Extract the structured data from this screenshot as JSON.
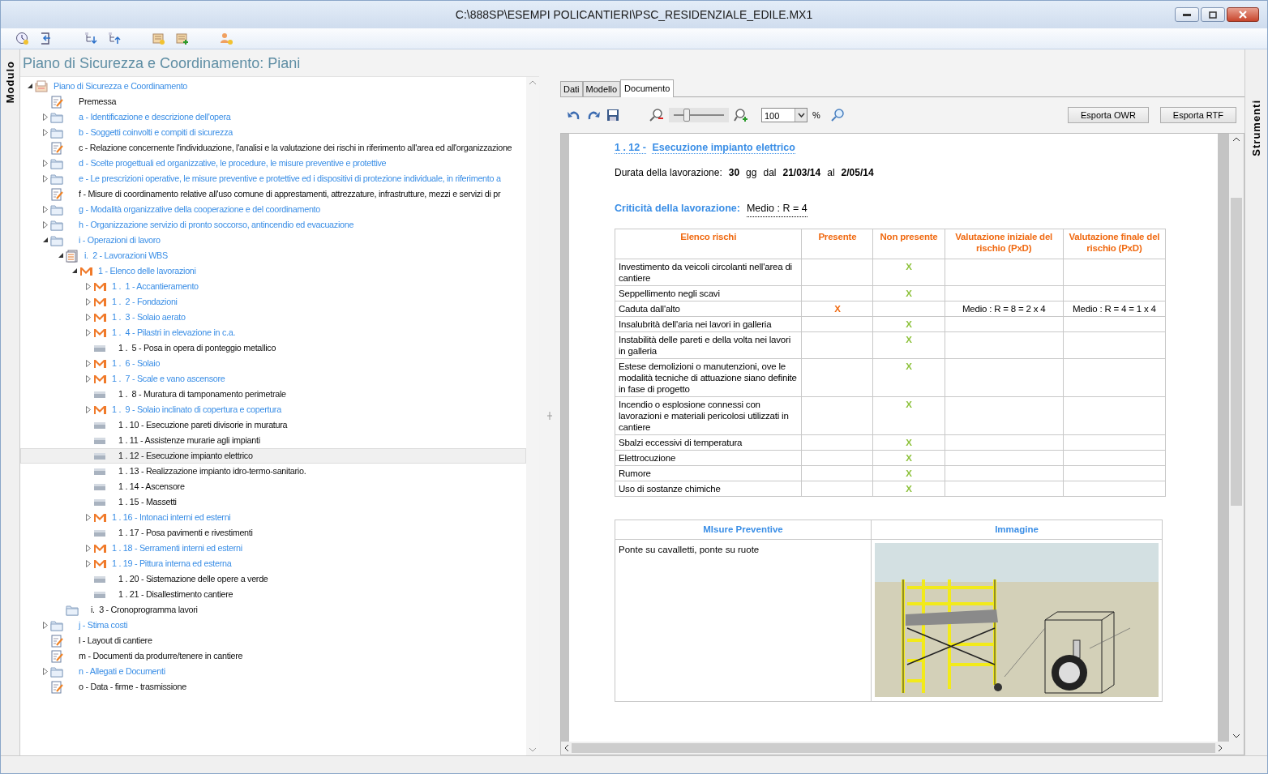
{
  "window": {
    "title": "C:\\888SP\\ESEMPI POLICANTIERI\\PSC_RESIDENZIALE_EDILE.MX1"
  },
  "side_tabs": {
    "left": "Modulo",
    "right": "Strumenti"
  },
  "panel_title": "Piano di Sicurezza e Coordinamento: Piani",
  "tree": [
    {
      "text": "Piano di Sicurezza e Coordinamento",
      "kind": "plan",
      "expanded": true,
      "selected": false,
      "children": [
        {
          "text": "Premessa",
          "kind": "document",
          "selected": false
        },
        {
          "text": "a - Identificazione e descrizione dell'opera",
          "kind": "folder",
          "expanded": false,
          "selected": false
        },
        {
          "text": "b - Soggetti coinvolti e compiti di sicurezza",
          "kind": "folder",
          "expanded": false,
          "selected": false
        },
        {
          "text": "c - Relazione concernente l'individuazione, l'analisi e la valutazione dei rischi in riferimento all'area ed all'organizzazione",
          "kind": "document",
          "selected": false
        },
        {
          "text": "d - Scelte progettuali ed organizzative, le procedure, le misure preventive e protettive",
          "kind": "folder",
          "expanded": false,
          "selected": false
        },
        {
          "text": "e - Le prescrizioni operative, le misure preventive e protettive ed i dispositivi di protezione individuale, in riferimento a",
          "kind": "folder",
          "expanded": false,
          "selected": false
        },
        {
          "text": "f - Misure di coordinamento relative all'uso comune di apprestamenti, attrezzature, infrastrutture, mezzi e servizi di pr",
          "kind": "document",
          "selected": false
        },
        {
          "text": "g - Modalità organizzative della cooperazione e del coordinamento",
          "kind": "folder",
          "expanded": false,
          "selected": false
        },
        {
          "text": "h - Organizzazione servizio di pronto soccorso, antincendio ed evacuazione",
          "kind": "folder",
          "expanded": false,
          "selected": false
        },
        {
          "text": "i - Operazioni di lavoro",
          "kind": "folder",
          "expanded": true,
          "selected": false,
          "children": [
            {
              "text": "i.  2 - Lavorazioni WBS",
              "kind": "wbs",
              "expanded": true,
              "selected": false,
              "children": [
                {
                  "text": "1 - Elenco delle lavorazioni",
                  "kind": "activity",
                  "expanded": true,
                  "selected": false,
                  "children": [
                    {
                      "text": "1 .  1 - Accantieramento",
                      "kind": "activity",
                      "expanded": false,
                      "selected": false
                    },
                    {
                      "text": "1 .  2 - Fondazioni",
                      "kind": "activity",
                      "expanded": false,
                      "selected": false
                    },
                    {
                      "text": "1 .  3 - Solaio aerato",
                      "kind": "activity",
                      "expanded": false,
                      "selected": false
                    },
                    {
                      "text": "1 .  4 - Pilastri in elevazione in c.a.",
                      "kind": "activity",
                      "expanded": false,
                      "selected": false
                    },
                    {
                      "text": "1 .  5 - Posa in opera di ponteggio metallico",
                      "kind": "task",
                      "selected": false
                    },
                    {
                      "text": "1 .  6 - Solaio",
                      "kind": "activity",
                      "expanded": false,
                      "selected": false
                    },
                    {
                      "text": "1 .  7 - Scale e vano ascensore",
                      "kind": "activity",
                      "expanded": false,
                      "selected": false
                    },
                    {
                      "text": "1 .  8 - Muratura di tamponamento perimetrale",
                      "kind": "task",
                      "selected": false
                    },
                    {
                      "text": "1 .  9 - Solaio inclinato di copertura e copertura",
                      "kind": "activity",
                      "expanded": false,
                      "selected": false
                    },
                    {
                      "text": "1 . 10 - Esecuzione pareti divisorie in muratura",
                      "kind": "task",
                      "selected": false
                    },
                    {
                      "text": "1 . 11 - Assistenze murarie agli impianti",
                      "kind": "task",
                      "selected": false
                    },
                    {
                      "text": "1 . 12 - Esecuzione impianto elettrico",
                      "kind": "task",
                      "selected": true
                    },
                    {
                      "text": "1 . 13 - Realizzazione impianto idro-termo-sanitario.",
                      "kind": "task",
                      "selected": false
                    },
                    {
                      "text": "1 . 14 - Ascensore",
                      "kind": "task",
                      "selected": false
                    },
                    {
                      "text": "1 . 15 - Massetti",
                      "kind": "task",
                      "selected": false
                    },
                    {
                      "text": "1 . 16 - Intonaci interni ed esterni",
                      "kind": "activity",
                      "expanded": false,
                      "selected": false
                    },
                    {
                      "text": "1 . 17 - Posa pavimenti e rivestimenti",
                      "kind": "task",
                      "selected": false
                    },
                    {
                      "text": "1 . 18 - Serramenti interni ed esterni",
                      "kind": "activity",
                      "expanded": false,
                      "selected": false
                    },
                    {
                      "text": "1 . 19 - Pittura interna ed esterna",
                      "kind": "activity",
                      "expanded": false,
                      "selected": false
                    },
                    {
                      "text": "1 . 20 - Sistemazione delle opere a verde",
                      "kind": "task",
                      "selected": false
                    },
                    {
                      "text": "1 . 21 - Disallestimento cantiere",
                      "kind": "task",
                      "selected": false
                    }
                  ]
                }
              ]
            },
            {
              "text": "i.  3 - Cronoprogramma lavori",
              "kind": "folder",
              "selected": false
            }
          ]
        },
        {
          "text": "j - Stima costi",
          "kind": "folder",
          "expanded": false,
          "selected": false
        },
        {
          "text": "l - Layout di cantiere",
          "kind": "document",
          "selected": false
        },
        {
          "text": "m - Documenti da produrre/tenere in cantiere",
          "kind": "document",
          "selected": false
        },
        {
          "text": "n - Allegati e Documenti",
          "kind": "folder",
          "expanded": false,
          "selected": false
        },
        {
          "text": "o - Data - firme - trasmissione",
          "kind": "document",
          "selected": false
        }
      ]
    }
  ],
  "detail_tabs": [
    {
      "label": "Dati",
      "selected": false
    },
    {
      "label": "Modello",
      "selected": false
    },
    {
      "label": "Documento",
      "selected": true
    }
  ],
  "zoom": {
    "level": 0.25,
    "value": "100",
    "unit": "%"
  },
  "export_buttons": [
    "Esporta OWR",
    "Esporta RTF"
  ],
  "document": {
    "heading_number": "1 . 12 -",
    "heading_title": "Esecuzione impianto elettrico",
    "duration_label": "Durata della lavorazione:",
    "duration": "30",
    "duration_unit": "gg",
    "from_label": "dal",
    "from": "21/03/14",
    "to_label": "al",
    "to": "2/05/14",
    "criticality_label": "Criticità della lavorazione:",
    "criticality": "Medio : R = 4",
    "risk_table": {
      "columns": [
        "Elenco rischi",
        "Presente",
        "Non presente",
        "Valutazione iniziale del rischio (PxD)",
        "Valutazione finale del rischio (PxD)"
      ],
      "rows": [
        {
          "name": "Investimento da veicoli circolanti nell'area di cantiere",
          "mark": "X",
          "present": false
        },
        {
          "name": "Seppellimento negli scavi",
          "mark": "X",
          "present": false
        },
        {
          "name": "Caduta dall'alto",
          "mark": "X",
          "present": true,
          "initial": "Medio : R = 8 = 2 x 4",
          "final": "Medio : R = 4 = 1 x 4"
        },
        {
          "name": "Insalubrità dell'aria nei lavori in galleria",
          "mark": "X",
          "present": false
        },
        {
          "name": "Instabilità delle pareti e della volta nei lavori in galleria",
          "mark": "X",
          "present": false
        },
        {
          "name": "Estese demolizioni o manutenzioni, ove le modalità tecniche di attuazione siano definite in fase di progetto",
          "mark": "X",
          "present": false
        },
        {
          "name": "Incendio o esplosione connessi con lavorazioni e materiali pericolosi utilizzati in cantiere",
          "mark": "X",
          "present": false
        },
        {
          "name": "Sbalzi eccessivi di temperatura",
          "mark": "X",
          "present": false
        },
        {
          "name": "Elettrocuzione",
          "mark": "X",
          "present": false
        },
        {
          "name": "Rumore",
          "mark": "X",
          "present": false
        },
        {
          "name": "Uso di sostanze chimiche",
          "mark": "X",
          "present": false
        }
      ]
    },
    "measures_table": {
      "columns": [
        "MIsure Preventive",
        "Immagine"
      ],
      "measures": "Ponte su cavalletti, ponte su ruote",
      "image": {
        "kind": "picture"
      }
    }
  }
}
